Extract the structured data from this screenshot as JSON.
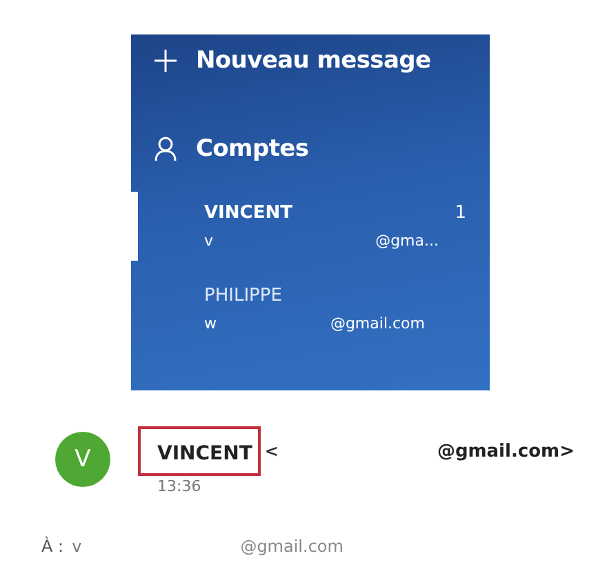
{
  "menu": [
    {
      "kind": "new",
      "label": "Nouveau message"
    },
    {
      "kind": "accounts",
      "label": "Comptes"
    }
  ],
  "accounts": [
    {
      "name": "VINCENT",
      "user": "v",
      "domain": "@gma...",
      "count": "1",
      "selected": true
    },
    {
      "name": "PHILIPPE",
      "user": "w",
      "domain": "@gmail.com",
      "selected": false
    }
  ],
  "message": {
    "avatar": "V",
    "sender": "VINCENT",
    "highlighted": true,
    "open": "<",
    "address": "@gmail.com>",
    "time": "13:36",
    "to_label": "À :",
    "to_user": "v",
    "to_domain": "@gmail.com"
  }
}
